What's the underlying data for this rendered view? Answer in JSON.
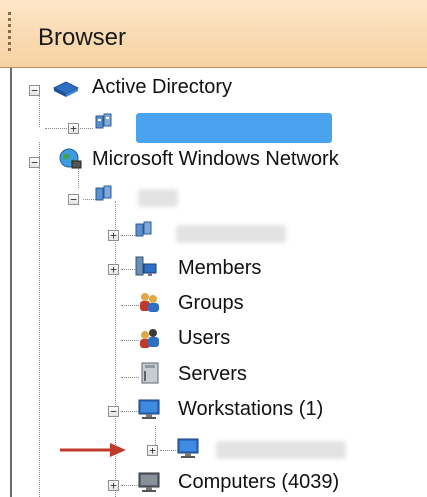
{
  "panel": {
    "title": "Browser"
  },
  "tree": {
    "active_directory": "Active Directory",
    "ms_windows_network": "Microsoft Windows Network",
    "members": "Members",
    "groups": "Groups",
    "users": "Users",
    "servers": "Servers",
    "workstations": "Workstations (1)",
    "computers": "Computers (4039)"
  },
  "expander": {
    "plus": "+",
    "minus": "−"
  },
  "colors": {
    "redaction_blue": "#4aa3ef",
    "arrow": "#c0392b",
    "header": "#f7d2a2"
  }
}
